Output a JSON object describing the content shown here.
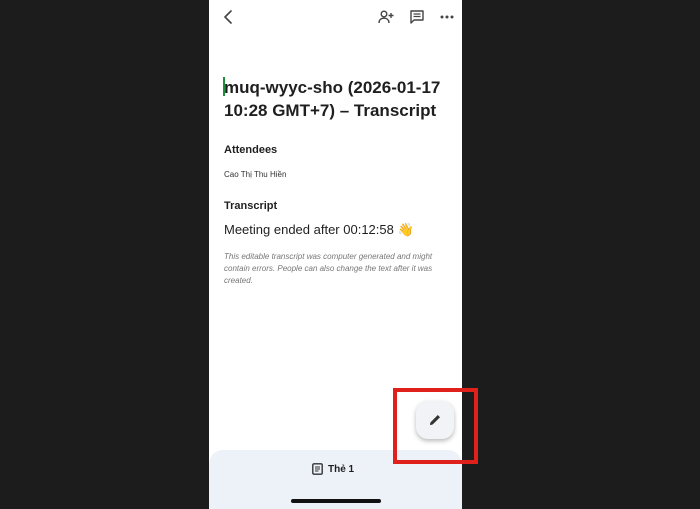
{
  "document": {
    "title": "muq-wyyc-sho (2026-01-17 10:28 GMT+7) – Transcript",
    "attendees_heading": "Attendees",
    "attendees": [
      "Cao Thị Thu Hiền"
    ],
    "transcript_heading": "Transcript",
    "meeting_line": "Meeting ended after 00:12:58 👋",
    "disclaimer": "This editable transcript was computer generated and might contain errors. People can also change the text after it was created."
  },
  "topbar": {
    "icons": [
      "back-arrow-icon",
      "add-person-icon",
      "comment-icon",
      "more-horizontal-icon"
    ]
  },
  "bottom_bar": {
    "tab_label": "Thẻ 1",
    "tab_icon": "document-icon"
  },
  "fab": {
    "icon": "pencil-icon"
  },
  "colors": {
    "background": "#1c1c1c",
    "cursor": "#1e8e3e",
    "highlight": "#e0201b",
    "bottom_bar": "#edf1f8"
  }
}
